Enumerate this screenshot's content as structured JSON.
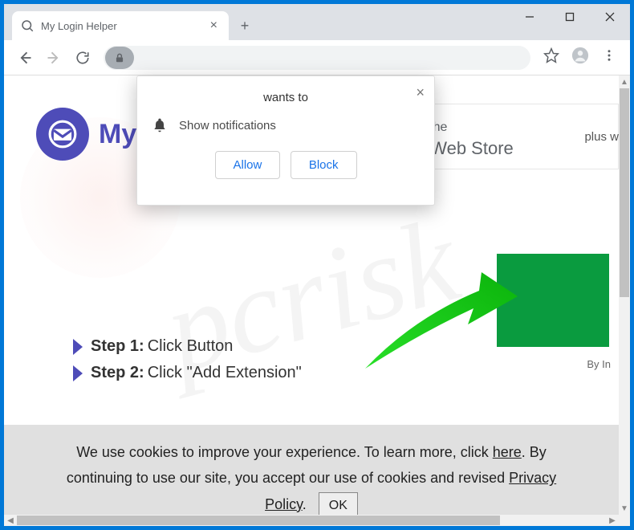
{
  "window": {
    "tab_title": "My Login Helper",
    "new_tab": "+"
  },
  "brand": {
    "text": "My"
  },
  "store": {
    "line1": "lable in the",
    "line2": "rome Web Store"
  },
  "plus_text": "plus w",
  "steps": {
    "s1_label": "Step 1:",
    "s1_text": " Click Button",
    "s2_label": "Step 2:",
    "s2_text": " Click \"Add Extension\""
  },
  "by": "By In",
  "cookie": {
    "text1": "We use cookies to improve your experience. To learn more, click ",
    "here": "here",
    "text2": ". By continuing to use our site, you accept our use of cookies and revised ",
    "pp": "Privacy Policy",
    "text3": ".",
    "ok": "OK"
  },
  "notification": {
    "wants": "wants to",
    "body": "Show notifications",
    "allow": "Allow",
    "block": "Block"
  },
  "watermark": "pcrisk"
}
